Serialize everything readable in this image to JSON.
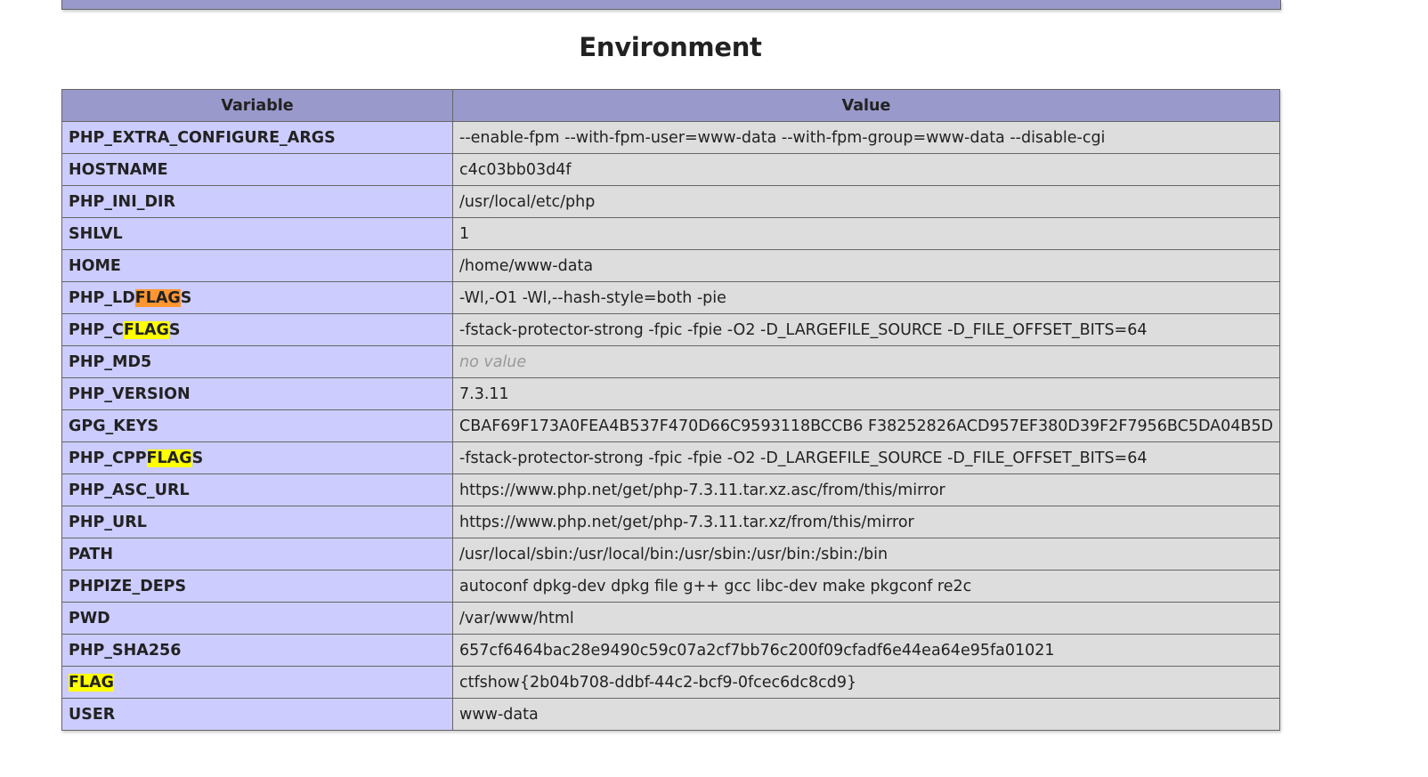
{
  "section_title": "Environment",
  "table": {
    "headers": [
      "Variable",
      "Value"
    ],
    "rows": [
      {
        "pre": "PHP_EXTRA_CONFIGURE_ARGS",
        "hl": "",
        "post": "",
        "value": "--enable-fpm --with-fpm-user=www-data --with-fpm-group=www-data --disable-cgi"
      },
      {
        "pre": "HOSTNAME",
        "hl": "",
        "post": "",
        "value": "c4c03bb03d4f"
      },
      {
        "pre": "PHP_INI_DIR",
        "hl": "",
        "post": "",
        "value": "/usr/local/etc/php"
      },
      {
        "pre": "SHLVL",
        "hl": "",
        "post": "",
        "value": "1"
      },
      {
        "pre": "HOME",
        "hl": "",
        "post": "",
        "value": "/home/www-data"
      },
      {
        "pre": "PHP_LD",
        "hl": "FLAG",
        "post": "S",
        "current": true,
        "value": "-Wl,-O1 -Wl,--hash-style=both -pie"
      },
      {
        "pre": "PHP_C",
        "hl": "FLAG",
        "post": "S",
        "value": "-fstack-protector-strong -fpic -fpie -O2 -D_LARGEFILE_SOURCE -D_FILE_OFFSET_BITS=64"
      },
      {
        "pre": "PHP_MD5",
        "hl": "",
        "post": "",
        "value": "no value",
        "novalue": true
      },
      {
        "pre": "PHP_VERSION",
        "hl": "",
        "post": "",
        "value": "7.3.11"
      },
      {
        "pre": "GPG_KEYS",
        "hl": "",
        "post": "",
        "value": "CBAF69F173A0FEA4B537F470D66C9593118BCCB6 F38252826ACD957EF380D39F2F7956BC5DA04B5D"
      },
      {
        "pre": "PHP_CPP",
        "hl": "FLAG",
        "post": "S",
        "value": "-fstack-protector-strong -fpic -fpie -O2 -D_LARGEFILE_SOURCE -D_FILE_OFFSET_BITS=64"
      },
      {
        "pre": "PHP_ASC_URL",
        "hl": "",
        "post": "",
        "value": "https://www.php.net/get/php-7.3.11.tar.xz.asc/from/this/mirror"
      },
      {
        "pre": "PHP_URL",
        "hl": "",
        "post": "",
        "value": "https://www.php.net/get/php-7.3.11.tar.xz/from/this/mirror"
      },
      {
        "pre": "PATH",
        "hl": "",
        "post": "",
        "value": "/usr/local/sbin:/usr/local/bin:/usr/sbin:/usr/bin:/sbin:/bin"
      },
      {
        "pre": "PHPIZE_DEPS",
        "hl": "",
        "post": "",
        "value": "autoconf dpkg-dev dpkg file g++ gcc libc-dev make pkgconf re2c"
      },
      {
        "pre": "PWD",
        "hl": "",
        "post": "",
        "value": "/var/www/html"
      },
      {
        "pre": "PHP_SHA256",
        "hl": "",
        "post": "",
        "value": "657cf6464bac28e9490c59c07a2cf7bb76c200f09cfadf6e44ea64e95fa01021"
      },
      {
        "pre": "",
        "hl": "FLAG",
        "post": "",
        "value": "ctfshow{2b04b708-ddbf-44c2-bcf9-0fcec6dc8cd9}"
      },
      {
        "pre": "USER",
        "hl": "",
        "post": "",
        "value": "www-data"
      }
    ]
  }
}
